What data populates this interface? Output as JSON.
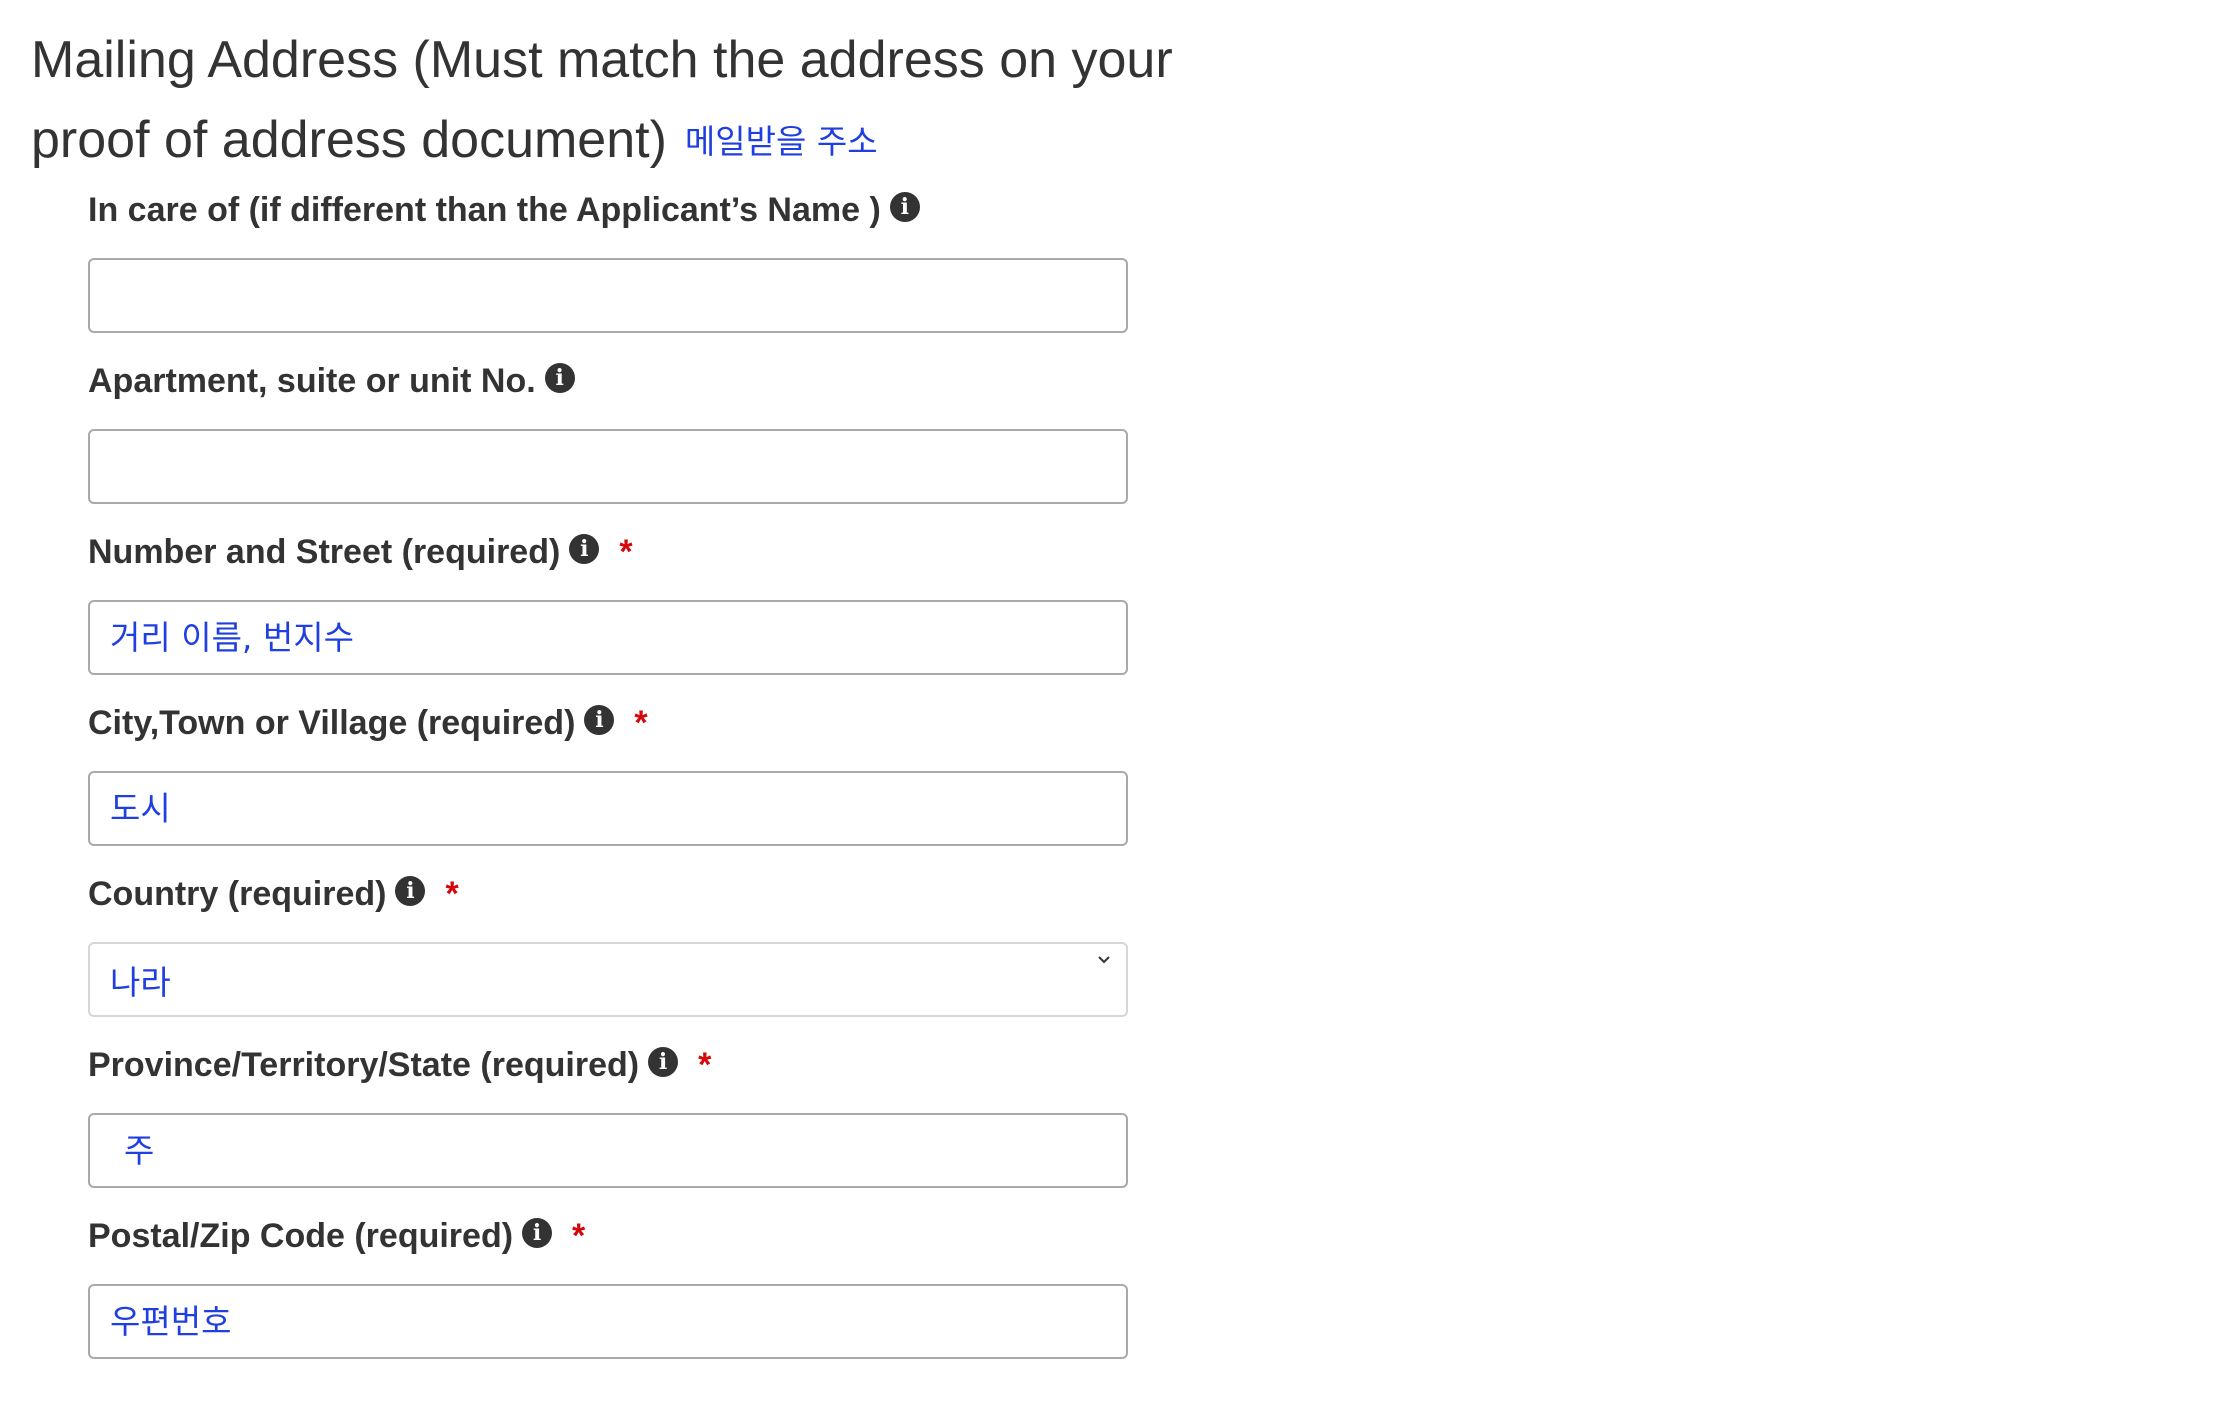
{
  "page": {
    "title": "Mailing Address (Must match the address on your proof of address document)",
    "title_translation": "메일받을 주소"
  },
  "fields": [
    {
      "label": "In care of (if different than the Applicant’s Name )",
      "info_icon": "info-icon",
      "required": false,
      "value": "",
      "placeholder": ""
    },
    {
      "label": "Apartment, suite or unit No.",
      "info_icon": "info-icon",
      "required": false,
      "value": "",
      "placeholder": ""
    },
    {
      "label": "Number and Street (required)",
      "info_icon": "info-icon",
      "required": true,
      "required_mark": "*",
      "value": "",
      "placeholder": "거리 이름, 번지수"
    },
    {
      "label": "City,Town or Village (required)",
      "info_icon": "info-icon",
      "required": true,
      "required_mark": "*",
      "value": "",
      "placeholder": "도시"
    },
    {
      "label": "Country (required)",
      "info_icon": "info-icon",
      "required": true,
      "required_mark": "*",
      "selected": "나라",
      "dropdown_icon": "chevron-down-icon"
    },
    {
      "label": "Province/Territory/State (required)",
      "info_icon": "info-icon",
      "required": true,
      "required_mark": "*",
      "value": "",
      "placeholder": "주"
    },
    {
      "label": "Postal/Zip Code (required)",
      "info_icon": "info-icon",
      "required": true,
      "required_mark": "*",
      "value": "",
      "placeholder": "우편번호"
    }
  ],
  "colors": {
    "text": "#333333",
    "hint": "#1f3fe0",
    "required": "#d3080c",
    "input_border": "#a9a9a9",
    "select_border": "#d6d6d6"
  }
}
